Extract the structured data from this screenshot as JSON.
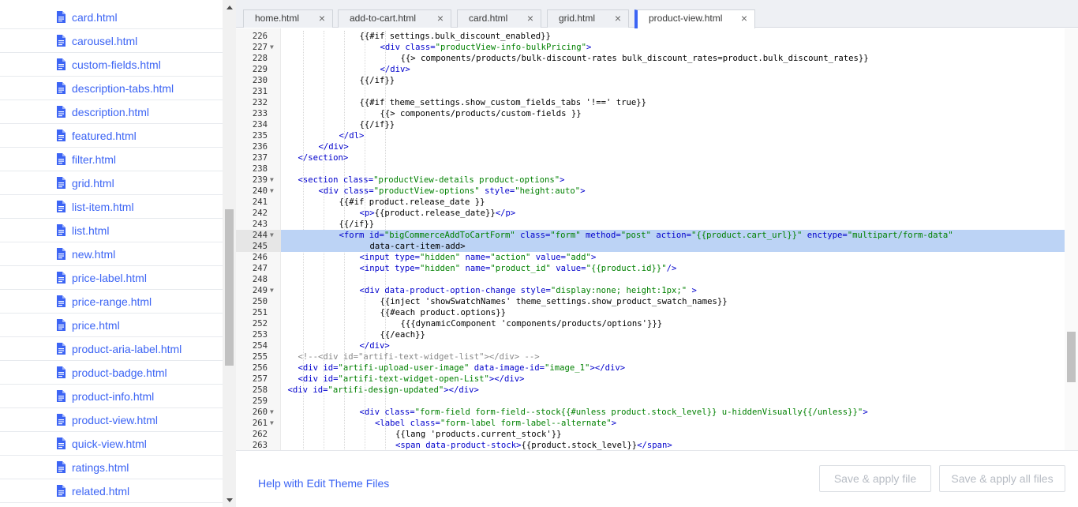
{
  "sidebar": {
    "files": [
      "card.html",
      "carousel.html",
      "custom-fields.html",
      "description-tabs.html",
      "description.html",
      "featured.html",
      "filter.html",
      "grid.html",
      "list-item.html",
      "list.html",
      "new.html",
      "price-label.html",
      "price-range.html",
      "price.html",
      "product-aria-label.html",
      "product-badge.html",
      "product-info.html",
      "product-view.html",
      "quick-view.html",
      "ratings.html",
      "related.html"
    ],
    "file_icon": "file-document-icon"
  },
  "tabs": [
    {
      "label": "home.html",
      "close": "×",
      "active": false
    },
    {
      "label": "add-to-cart.html",
      "close": "×",
      "active": false
    },
    {
      "label": "card.html",
      "close": "×",
      "active": false
    },
    {
      "label": "grid.html",
      "close": "×",
      "active": false
    },
    {
      "label": "product-view.html",
      "close": "×",
      "active": true
    }
  ],
  "code": {
    "highlighted_lines": [
      244,
      245
    ],
    "lines": [
      {
        "n": "226",
        "fold": false,
        "indent": 11,
        "t": "{{#if settings.bulk_discount_enabled}}"
      },
      {
        "n": "227",
        "fold": true,
        "indent": 15,
        "t": "<div class=\"productView-info-bulkPricing\">"
      },
      {
        "n": "228",
        "fold": false,
        "indent": 19,
        "t": "{{> components/products/bulk-discount-rates bulk_discount_rates=product.bulk_discount_rates}}"
      },
      {
        "n": "229",
        "fold": false,
        "indent": 15,
        "t": "</div>"
      },
      {
        "n": "230",
        "fold": false,
        "indent": 11,
        "t": "{{/if}}"
      },
      {
        "n": "231",
        "fold": false,
        "indent": 0,
        "t": ""
      },
      {
        "n": "232",
        "fold": false,
        "indent": 11,
        "t": "{{#if theme_settings.show_custom_fields_tabs '!==' true}}"
      },
      {
        "n": "233",
        "fold": false,
        "indent": 15,
        "t": "{{> components/products/custom-fields }}"
      },
      {
        "n": "234",
        "fold": false,
        "indent": 11,
        "t": "{{/if}}"
      },
      {
        "n": "235",
        "fold": false,
        "indent": 7,
        "t": "</dl>"
      },
      {
        "n": "236",
        "fold": false,
        "indent": 3,
        "t": "</div>"
      },
      {
        "n": "237",
        "fold": false,
        "indent": -1,
        "t": "</section>"
      },
      {
        "n": "238",
        "fold": false,
        "indent": 0,
        "t": ""
      },
      {
        "n": "239",
        "fold": true,
        "indent": -1,
        "t": "<section class=\"productView-details product-options\">"
      },
      {
        "n": "240",
        "fold": true,
        "indent": 3,
        "t": "<div class=\"productView-options\" style=\"height:auto\">"
      },
      {
        "n": "241",
        "fold": false,
        "indent": 7,
        "t": "{{#if product.release_date }}"
      },
      {
        "n": "242",
        "fold": false,
        "indent": 11,
        "t": "<p>{{product.release_date}}</p>"
      },
      {
        "n": "243",
        "fold": false,
        "indent": 7,
        "t": "{{/if}}"
      },
      {
        "n": "244",
        "fold": true,
        "indent": 7,
        "t": "<form id=\"bigCommerceAddToCartForm\" class=\"form\" method=\"post\" action=\"{{product.cart_url}}\" enctype=\"multipart/form-data\""
      },
      {
        "n": "245",
        "fold": false,
        "indent": 13,
        "t": "data-cart-item-add>"
      },
      {
        "n": "246",
        "fold": false,
        "indent": 11,
        "t": "<input type=\"hidden\" name=\"action\" value=\"add\">"
      },
      {
        "n": "247",
        "fold": false,
        "indent": 11,
        "t": "<input type=\"hidden\" name=\"product_id\" value=\"{{product.id}}\"/>"
      },
      {
        "n": "248",
        "fold": false,
        "indent": 0,
        "t": ""
      },
      {
        "n": "249",
        "fold": true,
        "indent": 11,
        "t": "<div data-product-option-change style=\"display:none; height:1px;\" >"
      },
      {
        "n": "250",
        "fold": false,
        "indent": 15,
        "t": "{{inject 'showSwatchNames' theme_settings.show_product_swatch_names}}"
      },
      {
        "n": "251",
        "fold": false,
        "indent": 15,
        "t": "{{#each product.options}}"
      },
      {
        "n": "252",
        "fold": false,
        "indent": 19,
        "t": "{{{dynamicComponent 'components/products/options'}}}"
      },
      {
        "n": "253",
        "fold": false,
        "indent": 15,
        "t": "{{/each}}"
      },
      {
        "n": "254",
        "fold": false,
        "indent": 11,
        "t": "</div>"
      },
      {
        "n": "255",
        "fold": false,
        "indent": -1,
        "t": "<!--<div id=\"artifi-text-widget-list\"></div> -->"
      },
      {
        "n": "256",
        "fold": false,
        "indent": -1,
        "t": "<div id=\"artifi-upload-user-image\" data-image-id=\"image_1\"></div>"
      },
      {
        "n": "257",
        "fold": false,
        "indent": -1,
        "t": "<div id=\"artifi-text-widget-open-List\"></div>"
      },
      {
        "n": "258",
        "fold": false,
        "indent": -3,
        "t": "<div id=\"artifi-design-updated\"></div>"
      },
      {
        "n": "259",
        "fold": false,
        "indent": 0,
        "t": ""
      },
      {
        "n": "260",
        "fold": true,
        "indent": 11,
        "t": "<div class=\"form-field form-field--stock{{#unless product.stock_level}} u-hiddenVisually{{/unless}}\">"
      },
      {
        "n": "261",
        "fold": true,
        "indent": 14,
        "t": "<label class=\"form-label form-label--alternate\">"
      },
      {
        "n": "262",
        "fold": false,
        "indent": 18,
        "t": "{{lang 'products.current_stock'}}"
      },
      {
        "n": "263",
        "fold": false,
        "indent": 18,
        "t": "<span data-product-stock>{{product.stock_level}}</span>"
      }
    ]
  },
  "footer": {
    "help_link": "Help with Edit Theme Files",
    "save_apply": "Save & apply file",
    "save_apply_all": "Save & apply all files"
  },
  "colors": {
    "accent": "#3c64f4",
    "highlight": "#bcd3f5"
  }
}
